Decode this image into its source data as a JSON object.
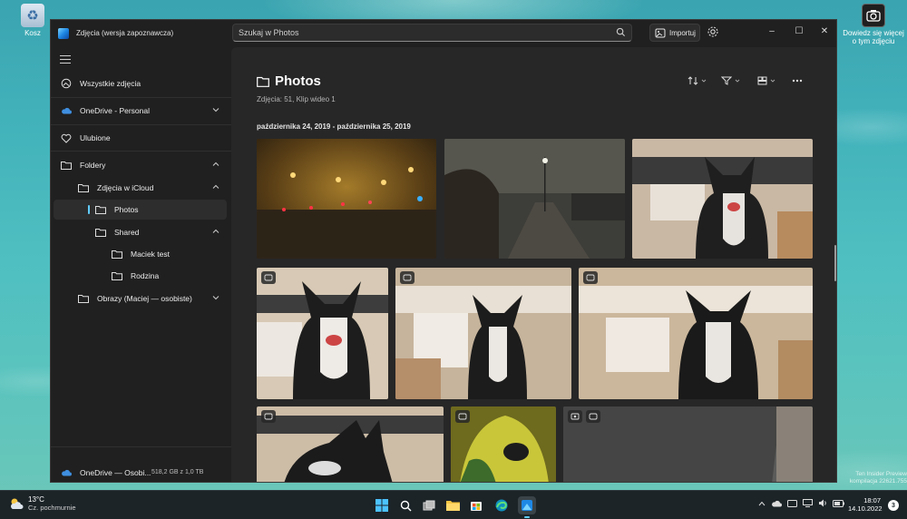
{
  "desktop": {
    "recycle_bin_label": "Kosz",
    "learn_label": "Dowiedz się więcej o tym zdjęciu"
  },
  "window": {
    "title": "Zdjęcia (wersja zapoznawcza)",
    "search_placeholder": "Szukaj w Photos",
    "import_label": "Importuj",
    "controls": {
      "minimize": "–",
      "maximize": "☐",
      "close": "✕"
    }
  },
  "sidebar": {
    "all_photos": "Wszystkie zdjęcia",
    "onedrive_personal": "OneDrive - Personal",
    "favorites": "Ulubione",
    "folders": "Foldery",
    "icloud": "Zdjęcia w iCloud",
    "photos": "Photos",
    "shared": "Shared",
    "maciek": "Maciek test",
    "rodzina": "Rodzina",
    "obrazy": "Obrazy (Maciej — osobiste)",
    "storage_label": "OneDrive — Osobi...",
    "storage_size": "518,2 GB z 1,0 TB",
    "storage_fraction": 0.51
  },
  "main": {
    "title": "Photos",
    "subtitle": "Zdjęcia: 51, Klip wideo 1",
    "date_range": "października 24, 2019 - października 25, 2019"
  },
  "photos": [
    {
      "scene": "foggy-street-night"
    },
    {
      "scene": "foggy-path-night"
    },
    {
      "scene": "dog-on-chair"
    },
    {
      "scene": "dog-smiling"
    },
    {
      "scene": "dog-sitting"
    },
    {
      "scene": "dog-closeup"
    },
    {
      "scene": "dog-profile"
    },
    {
      "scene": "cat-on-chair"
    },
    {
      "scene": "laptop-video"
    }
  ],
  "taskbar": {
    "temp": "13°C",
    "weather": "Cz. pochmurnie",
    "time": "18:07",
    "date": "14.10.2022",
    "notifications": "3"
  },
  "watermark": "Ten Insider Preview\nkompilacja 22621.755"
}
